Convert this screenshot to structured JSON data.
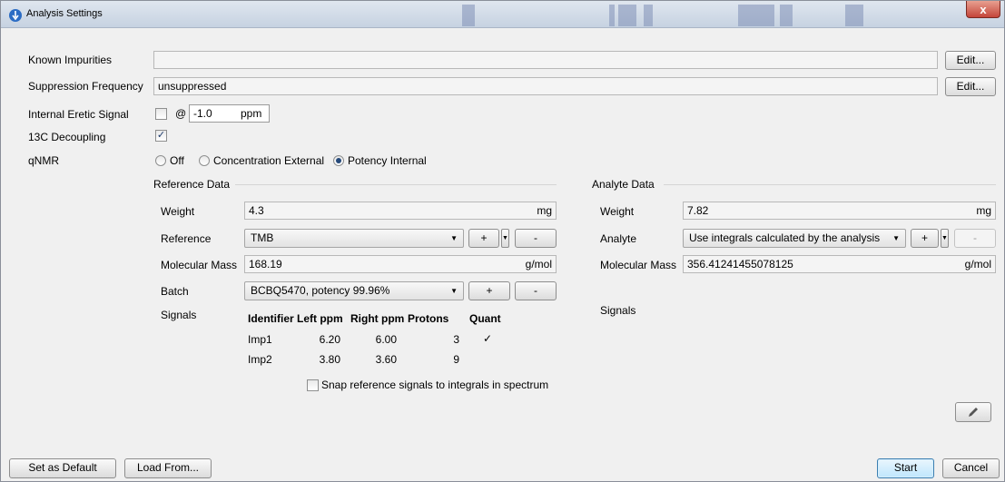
{
  "window": {
    "title": "Analysis Settings",
    "close_glyph": "x"
  },
  "top": {
    "known_impurities": {
      "label": "Known Impurities",
      "value": "",
      "edit": "Edit..."
    },
    "suppression": {
      "label": "Suppression Frequency",
      "value": "unsuppressed",
      "edit": "Edit..."
    },
    "internal_eretic": {
      "label": "Internal Eretic Signal",
      "checked": false,
      "at": "@",
      "value": "-1.0",
      "unit": "ppm"
    },
    "decoupling": {
      "label": "13C Decoupling",
      "checked": true
    },
    "qnmr": {
      "label": "qNMR",
      "options": [
        "Off",
        "Concentration External",
        "Potency Internal"
      ],
      "selected": "Potency Internal"
    }
  },
  "reference": {
    "heading": "Reference Data",
    "weight": {
      "label": "Weight",
      "value": "4.3",
      "unit": "mg"
    },
    "reference": {
      "label": "Reference",
      "value": "TMB",
      "plus": "+",
      "minus": "-"
    },
    "molecular_mass": {
      "label": "Molecular Mass",
      "value": "168.19",
      "unit": "g/mol"
    },
    "batch": {
      "label": "Batch",
      "value": "BCBQ5470, potency 99.96%",
      "plus": "+",
      "minus": "-"
    },
    "signals": {
      "label": "Signals",
      "columns": [
        "Identifier",
        "Left ppm",
        "Right ppm",
        "Protons",
        "Quant"
      ],
      "rows": [
        {
          "identifier": "Imp1",
          "left": "6.20",
          "right": "6.00",
          "protons": "3",
          "quant": "✓"
        },
        {
          "identifier": "Imp2",
          "left": "3.80",
          "right": "3.60",
          "protons": "9",
          "quant": ""
        }
      ]
    },
    "snap": {
      "label": "Snap reference signals to integrals in spectrum",
      "checked": false
    }
  },
  "analyte": {
    "heading": "Analyte Data",
    "weight": {
      "label": "Weight",
      "value": "7.82",
      "unit": "mg"
    },
    "analyte": {
      "label": "Analyte",
      "value": "Use integrals calculated by the analysis",
      "plus": "+",
      "minus": "-"
    },
    "molecular_mass": {
      "label": "Molecular Mass",
      "value": "356.41241455078125",
      "unit": "g/mol"
    },
    "signals": {
      "label": "Signals"
    }
  },
  "footer": {
    "set_default": "Set as Default",
    "load_from": "Load From...",
    "start": "Start",
    "cancel": "Cancel"
  },
  "icons": {
    "app": "app-icon",
    "edit": "pencil-icon",
    "dropdown": "chevron-down-icon"
  },
  "colors": {
    "window_bg": "#f0f0f0",
    "title_bg": "#c6d2e1",
    "close_red": "#c4453a",
    "primary_border": "#3c7fb1"
  }
}
